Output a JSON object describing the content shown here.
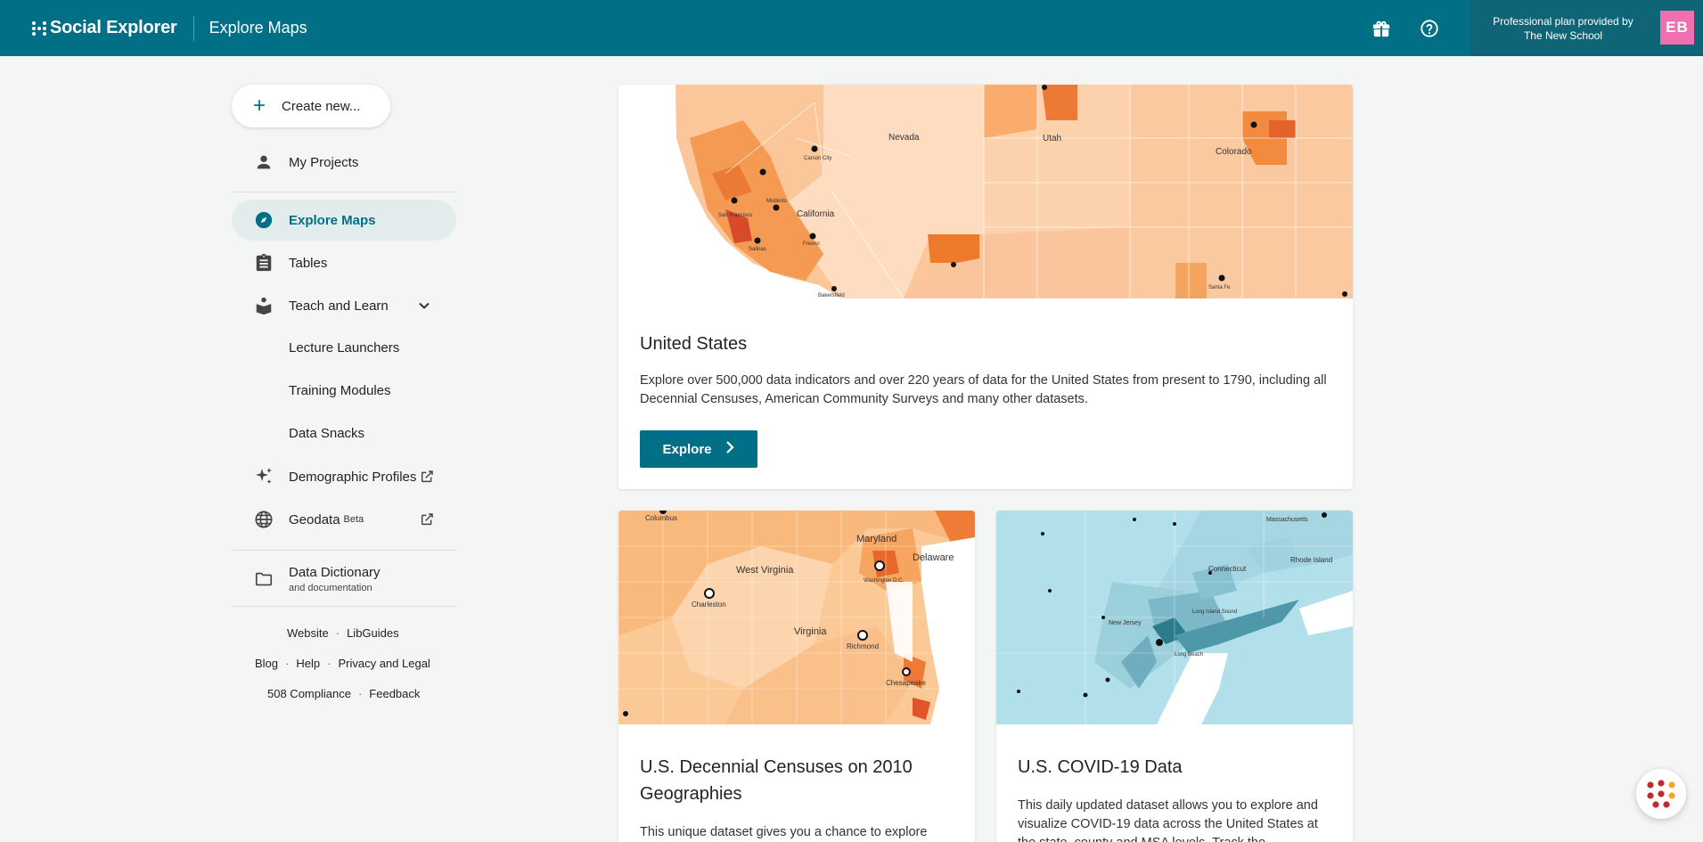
{
  "header": {
    "brand": "Social Explorer",
    "app_title": "Explore Maps",
    "plan_line1": "Professional plan provided by",
    "plan_line2": "The New School",
    "avatar_initials": "EB",
    "colors": {
      "bar": "#016f85",
      "plan_box": "#0f6476",
      "avatar": "#f06fb0"
    },
    "icons": [
      "gift-icon",
      "help-icon"
    ]
  },
  "sidebar": {
    "create_label": "Create new...",
    "items": {
      "my_projects": "My Projects",
      "explore_maps": "Explore Maps",
      "tables": "Tables",
      "teach_and_learn": "Teach and Learn",
      "lecture_launchers": "Lecture Launchers",
      "training_modules": "Training Modules",
      "data_snacks": "Data Snacks",
      "demographic_profiles": "Demographic Profiles",
      "geodata": "Geodata",
      "geodata_badge": "Beta",
      "data_dictionary": "Data Dictionary",
      "data_dictionary_sub": "and documentation"
    },
    "footer": {
      "website": "Website",
      "libguides": "LibGuides",
      "blog": "Blog",
      "help": "Help",
      "privacy": "Privacy and Legal",
      "compliance": "508 Compliance",
      "feedback": "Feedback"
    }
  },
  "cards": {
    "us": {
      "title": "United States",
      "description": "Explore over 500,000 data indicators and over 220 years of data for the United States from present to 1790, including all Decennial Censuses, American Community Surveys and many other datasets.",
      "button": "Explore",
      "map_labels": {
        "nevada": "Nevada",
        "utah": "Utah",
        "colorado": "Colorado",
        "california": "California",
        "san_francisco": "San Francisco",
        "fresno": "Fresno",
        "modesto": "Modesto",
        "salinas": "Salinas",
        "carson_city": "Carson City",
        "bakersfield": "Bakersfield",
        "santa_fe": "Santa Fe"
      }
    },
    "decennial": {
      "title": "U.S. Decennial Censuses on 2010 Geographies",
      "description": "This unique dataset gives you a chance to explore",
      "map_labels": {
        "columbus": "Columbus",
        "maryland": "Maryland",
        "delaware": "Delaware",
        "west_virginia": "West Virginia",
        "charleston": "Charleston",
        "virginia": "Virginia",
        "richmond": "Richmond",
        "chesapeake": "Chesapeake",
        "washington": "Washington D.C."
      }
    },
    "covid": {
      "title": "U.S. COVID-19 Data",
      "description": "This daily updated dataset allows you to explore and visualize COVID-19 data across the United States at the state, county and MSA levels. Track the",
      "map_labels": {
        "massachusetts": "Massachusetts",
        "connecticut": "Connecticut",
        "rhode_island": "Rhode Island",
        "new_jersey": "New Jersey",
        "long_island_sound": "Long Island Sound",
        "long_beach": "Long Beach"
      }
    }
  }
}
